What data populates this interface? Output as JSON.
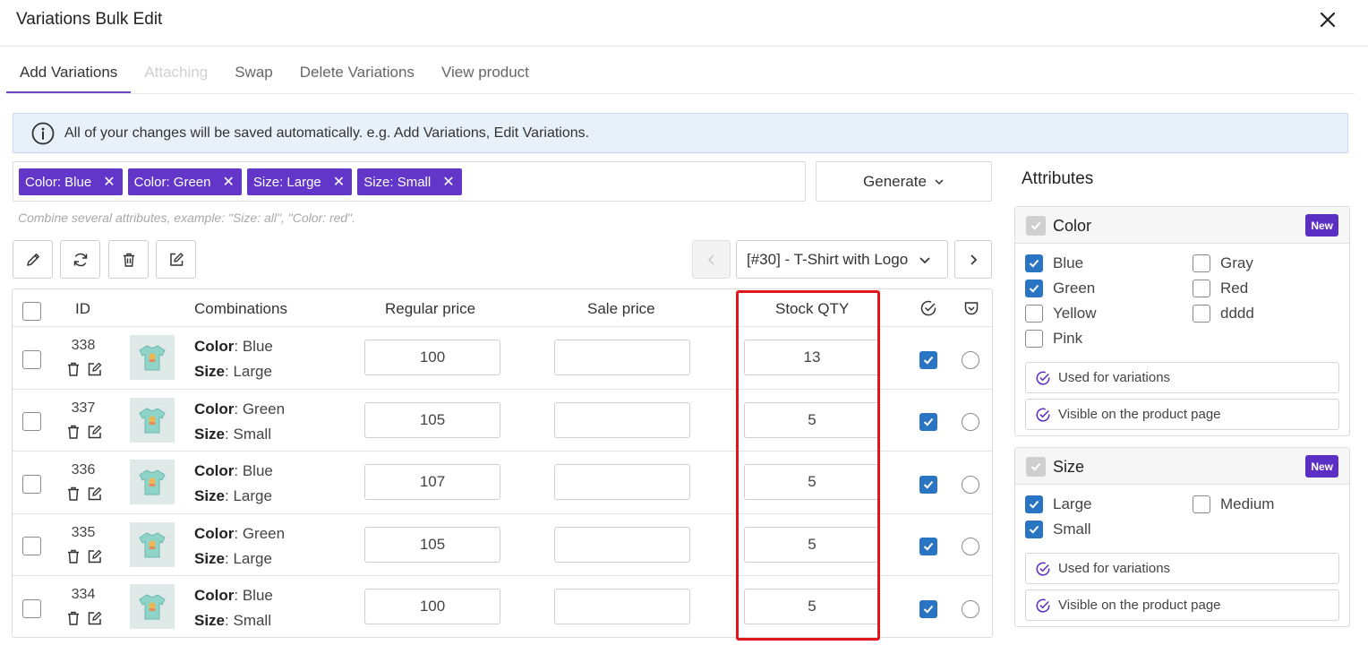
{
  "modal": {
    "title": "Variations Bulk Edit"
  },
  "tabs": [
    {
      "label": "Add Variations",
      "state": "active"
    },
    {
      "label": "Attaching",
      "state": "disabled"
    },
    {
      "label": "Swap",
      "state": "normal"
    },
    {
      "label": "Delete Variations",
      "state": "normal"
    },
    {
      "label": "View product",
      "state": "normal"
    }
  ],
  "info": {
    "text": "All of your changes will be saved automatically. e.g. Add Variations, Edit Variations."
  },
  "tags": [
    {
      "label": "Color: Blue"
    },
    {
      "label": "Color: Green"
    },
    {
      "label": "Size: Large"
    },
    {
      "label": "Size: Small"
    }
  ],
  "hint": "Combine several attributes, example: \"Size: all\", \"Color: red\".",
  "generate": {
    "label": "Generate"
  },
  "product_select": {
    "value": "[#30] - T-Shirt with Logo"
  },
  "table": {
    "headers": {
      "id": "ID",
      "combinations": "Combinations",
      "regular_price": "Regular price",
      "sale_price": "Sale price",
      "stock_qty": "Stock QTY"
    },
    "rows": [
      {
        "id": "338",
        "attr1_name": "Color",
        "attr1_value": ": Blue",
        "attr2_name": "Size",
        "attr2_value": ": Large",
        "regular_price": "100",
        "sale_price": "",
        "stock_qty": "13",
        "enabled": true,
        "default": false
      },
      {
        "id": "337",
        "attr1_name": "Color",
        "attr1_value": ": Green",
        "attr2_name": "Size",
        "attr2_value": ": Small",
        "regular_price": "105",
        "sale_price": "",
        "stock_qty": "5",
        "enabled": true,
        "default": false
      },
      {
        "id": "336",
        "attr1_name": "Color",
        "attr1_value": ": Blue",
        "attr2_name": "Size",
        "attr2_value": ": Large",
        "regular_price": "107",
        "sale_price": "",
        "stock_qty": "5",
        "enabled": true,
        "default": false
      },
      {
        "id": "335",
        "attr1_name": "Color",
        "attr1_value": ": Green",
        "attr2_name": "Size",
        "attr2_value": ": Large",
        "regular_price": "105",
        "sale_price": "",
        "stock_qty": "5",
        "enabled": true,
        "default": false
      },
      {
        "id": "334",
        "attr1_name": "Color",
        "attr1_value": ": Blue",
        "attr2_name": "Size",
        "attr2_value": ": Small",
        "regular_price": "100",
        "sale_price": "",
        "stock_qty": "5",
        "enabled": true,
        "default": false
      }
    ]
  },
  "attributes": {
    "title": "Attributes",
    "groups": [
      {
        "name": "Color",
        "badge": "New",
        "options": [
          {
            "label": "Blue",
            "checked": true
          },
          {
            "label": "Gray",
            "checked": false
          },
          {
            "label": "Green",
            "checked": true
          },
          {
            "label": "Red",
            "checked": false
          },
          {
            "label": "Yellow",
            "checked": false
          },
          {
            "label": "dddd",
            "checked": false
          },
          {
            "label": "Pink",
            "checked": false
          }
        ],
        "used_for_variations": "Used for variations",
        "visible_on_product_page": "Visible on the product page"
      },
      {
        "name": "Size",
        "badge": "New",
        "options": [
          {
            "label": "Large",
            "checked": true
          },
          {
            "label": "Medium",
            "checked": false
          },
          {
            "label": "Small",
            "checked": true
          }
        ],
        "used_for_variations": "Used for variations",
        "visible_on_product_page": "Visible on the product page"
      }
    ]
  },
  "colors": {
    "accent": "#6236c8",
    "checkbox": "#2a74c4",
    "highlight": "#e0161c",
    "info_bg": "#e8f0fa"
  }
}
